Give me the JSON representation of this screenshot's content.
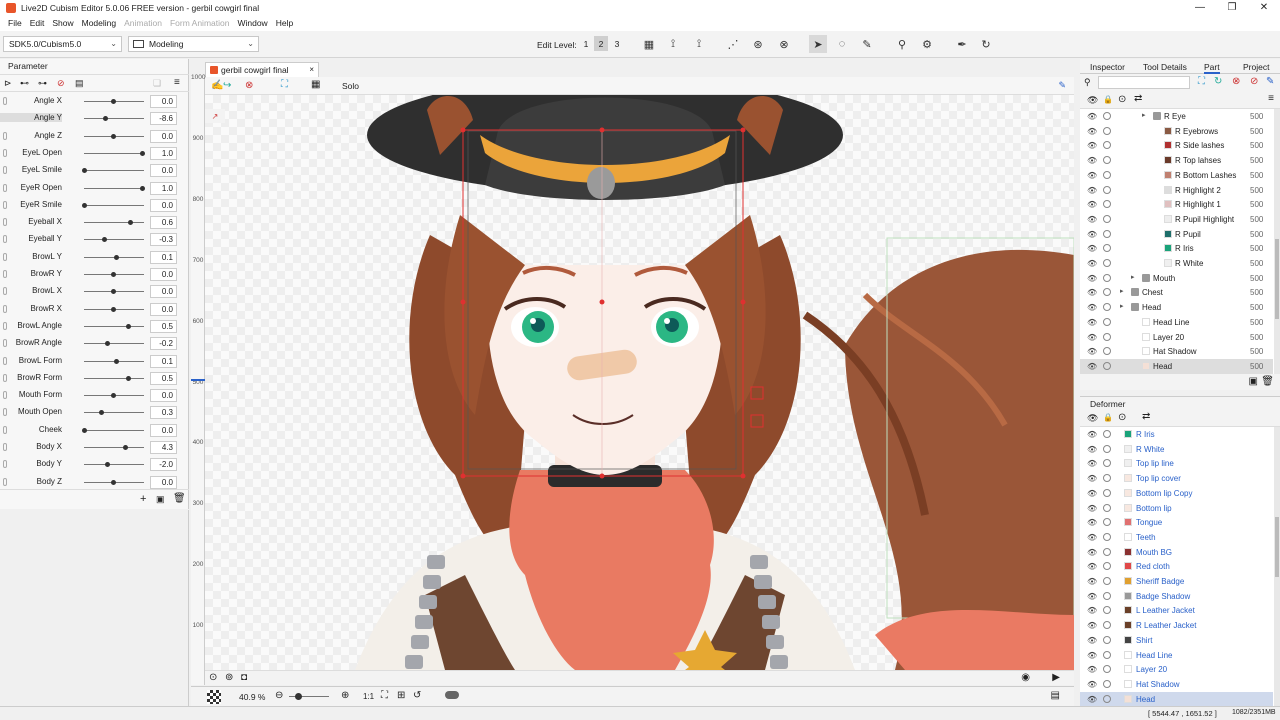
{
  "window": {
    "title": "Live2D Cubism Editor 5.0.06   FREE version  - gerbil cowgirl final",
    "controls": [
      "—",
      "❐",
      "✕"
    ]
  },
  "menu": [
    "File",
    "Edit",
    "Show",
    "Modeling",
    "Animation",
    "Form Animation",
    "Window",
    "Help"
  ],
  "menu_disabled": [
    "Animation",
    "Form Animation"
  ],
  "toolbar": {
    "sdk": "SDK5.0/Cubism5.0",
    "mode": "Modeling",
    "edit_level_label": "Edit Level:",
    "levels": [
      "1",
      "2",
      "3"
    ],
    "active_level": "2"
  },
  "parameter_panel": {
    "tab": "Parameter",
    "selected": "Angle Y",
    "params": [
      {
        "name": "Angle X",
        "value": "0.0",
        "pos": 0.5
      },
      {
        "name": "Angle Y",
        "value": "-8.6",
        "pos": 0.36
      },
      {
        "name": "Angle Z",
        "value": "0.0",
        "pos": 0.5
      },
      {
        "name": "EyeL Open",
        "value": "1.0",
        "pos": 1.0
      },
      {
        "name": "EyeL Smile",
        "value": "0.0",
        "pos": 0.0
      },
      {
        "name": "EyeR Open",
        "value": "1.0",
        "pos": 1.0
      },
      {
        "name": "EyeR Smile",
        "value": "0.0",
        "pos": 0.0
      },
      {
        "name": "Eyeball X",
        "value": "0.6",
        "pos": 0.8
      },
      {
        "name": "Eyeball Y",
        "value": "-0.3",
        "pos": 0.35
      },
      {
        "name": "BrowL Y",
        "value": "0.1",
        "pos": 0.55
      },
      {
        "name": "BrowR Y",
        "value": "0.0",
        "pos": 0.5
      },
      {
        "name": "BrowL X",
        "value": "0.0",
        "pos": 0.5
      },
      {
        "name": "BrowR X",
        "value": "0.0",
        "pos": 0.5
      },
      {
        "name": "BrowL Angle",
        "value": "0.5",
        "pos": 0.75
      },
      {
        "name": "BrowR Angle",
        "value": "-0.2",
        "pos": 0.4
      },
      {
        "name": "BrowL Form",
        "value": "0.1",
        "pos": 0.55
      },
      {
        "name": "BrowR Form",
        "value": "0.5",
        "pos": 0.75
      },
      {
        "name": "Mouth Form",
        "value": "0.0",
        "pos": 0.5
      },
      {
        "name": "Mouth Open",
        "value": "0.3",
        "pos": 0.3
      },
      {
        "name": "Cheek",
        "value": "0.0",
        "pos": 0.0
      },
      {
        "name": "Body X",
        "value": "4.3",
        "pos": 0.7
      },
      {
        "name": "Body Y",
        "value": "-2.0",
        "pos": 0.4
      },
      {
        "name": "Body Z",
        "value": "0.0",
        "pos": 0.5
      }
    ]
  },
  "document": {
    "tab": "gerbil cowgirl final",
    "solo_label": "Solo",
    "zoom": "40.9 %",
    "ratio": "1:1",
    "ruler_ticks": [
      "1000",
      "900",
      "800",
      "700",
      "600",
      "500",
      "400",
      "300",
      "200",
      "100"
    ]
  },
  "right_panel": {
    "tabs": [
      "Inspector",
      "Tool Details",
      "Part",
      "Project"
    ],
    "active_tab": "Part",
    "parts": [
      {
        "name": "R Eye",
        "opacity": "500",
        "indent": 3,
        "type": "folder",
        "color": "#888"
      },
      {
        "name": "R Eyebrows",
        "opacity": "500",
        "indent": 4,
        "type": "item",
        "color": "#8a5a44"
      },
      {
        "name": "R Side lashes",
        "opacity": "500",
        "indent": 4,
        "type": "item",
        "color": "#b03030"
      },
      {
        "name": "R Top lahses",
        "opacity": "500",
        "indent": 4,
        "type": "item",
        "color": "#6a3a2a"
      },
      {
        "name": "R Bottom Lashes",
        "opacity": "500",
        "indent": 4,
        "type": "item",
        "color": "#c08070"
      },
      {
        "name": "R Highlight 2",
        "opacity": "500",
        "indent": 4,
        "type": "item",
        "color": "#ddd"
      },
      {
        "name": "R Highlight 1",
        "opacity": "500",
        "indent": 4,
        "type": "item",
        "color": "#e0c0c0"
      },
      {
        "name": "R Pupil Highlight",
        "opacity": "500",
        "indent": 4,
        "type": "item",
        "color": "#eee"
      },
      {
        "name": "R Pupil",
        "opacity": "500",
        "indent": 4,
        "type": "item",
        "color": "#1e6e6a"
      },
      {
        "name": "R Iris",
        "opacity": "500",
        "indent": 4,
        "type": "item",
        "color": "#1aa37a"
      },
      {
        "name": "R  White",
        "opacity": "500",
        "indent": 4,
        "type": "item",
        "color": "#f0f0f0"
      },
      {
        "name": "Mouth",
        "opacity": "500",
        "indent": 2,
        "type": "folder",
        "color": "#888"
      },
      {
        "name": "Chest",
        "opacity": "500",
        "indent": 1,
        "type": "folder",
        "color": "#888"
      },
      {
        "name": "Head",
        "opacity": "500",
        "indent": 1,
        "type": "folder",
        "color": "#888"
      },
      {
        "name": "Head Line",
        "opacity": "500",
        "indent": 2,
        "type": "item",
        "color": "#fff"
      },
      {
        "name": "Layer 20",
        "opacity": "500",
        "indent": 2,
        "type": "item",
        "color": "#fff"
      },
      {
        "name": "Hat Shadow",
        "opacity": "500",
        "indent": 2,
        "type": "item",
        "color": "#fff"
      },
      {
        "name": "Head",
        "opacity": "500",
        "indent": 2,
        "type": "item",
        "color": "#f4e0d6"
      }
    ],
    "selected_part_index": 17
  },
  "deformer_panel": {
    "title": "Deformer",
    "items": [
      {
        "name": "R Iris",
        "color": "#1aa37a"
      },
      {
        "name": "R  White",
        "color": "#f0f0f0"
      },
      {
        "name": "Top lip line",
        "color": "#f0f0f0"
      },
      {
        "name": "Top lip cover",
        "color": "#f8e8e0"
      },
      {
        "name": "Bottom lip Copy",
        "color": "#f8e8e0"
      },
      {
        "name": "Bottom lip",
        "color": "#f8e8e0"
      },
      {
        "name": "Tongue",
        "color": "#e07070"
      },
      {
        "name": "Teeth",
        "color": "#fff"
      },
      {
        "name": "Mouth BG",
        "color": "#8a3030"
      },
      {
        "name": "Red cloth",
        "color": "#e04848"
      },
      {
        "name": "Sheriff Badge",
        "color": "#e0a030"
      },
      {
        "name": "Badge Shadow",
        "color": "#999"
      },
      {
        "name": "L Leather Jacket",
        "color": "#6a4028"
      },
      {
        "name": "R Leather Jacket",
        "color": "#6a4028"
      },
      {
        "name": "Shirt",
        "color": "#444"
      },
      {
        "name": "Head Line",
        "color": "#fff"
      },
      {
        "name": "Layer 20",
        "color": "#fff"
      },
      {
        "name": "Hat Shadow",
        "color": "#fff"
      },
      {
        "name": "Head",
        "color": "#f4e0d6"
      }
    ],
    "selected_index": 18
  },
  "statusbar": {
    "coords": "[ 5544.47 , 1651.52 ]",
    "memory": "1082/2351MB"
  },
  "colors": {
    "accent": "#e8552a",
    "selection_red": "#e03030",
    "link_blue": "#2a61c9"
  }
}
